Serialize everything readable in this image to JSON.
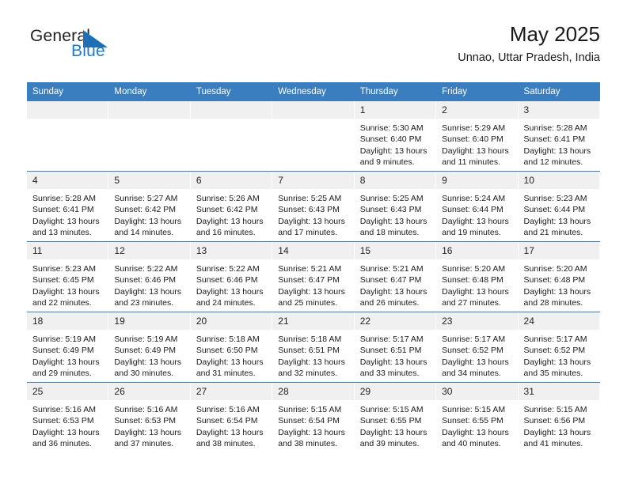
{
  "brand": {
    "name_part1": "General",
    "name_part2": "Blue",
    "triangle_color": "#1f6fb4",
    "blue_color": "#1e7ac4"
  },
  "header": {
    "title": "May 2025",
    "location": "Unnao, Uttar Pradesh, India",
    "accent_color": "#3a7ebf"
  },
  "weekdays": [
    "Sunday",
    "Monday",
    "Tuesday",
    "Wednesday",
    "Thursday",
    "Friday",
    "Saturday"
  ],
  "weeks": [
    [
      {
        "day": "",
        "sunrise": "",
        "sunset": "",
        "daylight": ""
      },
      {
        "day": "",
        "sunrise": "",
        "sunset": "",
        "daylight": ""
      },
      {
        "day": "",
        "sunrise": "",
        "sunset": "",
        "daylight": ""
      },
      {
        "day": "",
        "sunrise": "",
        "sunset": "",
        "daylight": ""
      },
      {
        "day": "1",
        "sunrise": "Sunrise: 5:30 AM",
        "sunset": "Sunset: 6:40 PM",
        "daylight": "Daylight: 13 hours and 9 minutes."
      },
      {
        "day": "2",
        "sunrise": "Sunrise: 5:29 AM",
        "sunset": "Sunset: 6:40 PM",
        "daylight": "Daylight: 13 hours and 11 minutes."
      },
      {
        "day": "3",
        "sunrise": "Sunrise: 5:28 AM",
        "sunset": "Sunset: 6:41 PM",
        "daylight": "Daylight: 13 hours and 12 minutes."
      }
    ],
    [
      {
        "day": "4",
        "sunrise": "Sunrise: 5:28 AM",
        "sunset": "Sunset: 6:41 PM",
        "daylight": "Daylight: 13 hours and 13 minutes."
      },
      {
        "day": "5",
        "sunrise": "Sunrise: 5:27 AM",
        "sunset": "Sunset: 6:42 PM",
        "daylight": "Daylight: 13 hours and 14 minutes."
      },
      {
        "day": "6",
        "sunrise": "Sunrise: 5:26 AM",
        "sunset": "Sunset: 6:42 PM",
        "daylight": "Daylight: 13 hours and 16 minutes."
      },
      {
        "day": "7",
        "sunrise": "Sunrise: 5:25 AM",
        "sunset": "Sunset: 6:43 PM",
        "daylight": "Daylight: 13 hours and 17 minutes."
      },
      {
        "day": "8",
        "sunrise": "Sunrise: 5:25 AM",
        "sunset": "Sunset: 6:43 PM",
        "daylight": "Daylight: 13 hours and 18 minutes."
      },
      {
        "day": "9",
        "sunrise": "Sunrise: 5:24 AM",
        "sunset": "Sunset: 6:44 PM",
        "daylight": "Daylight: 13 hours and 19 minutes."
      },
      {
        "day": "10",
        "sunrise": "Sunrise: 5:23 AM",
        "sunset": "Sunset: 6:44 PM",
        "daylight": "Daylight: 13 hours and 21 minutes."
      }
    ],
    [
      {
        "day": "11",
        "sunrise": "Sunrise: 5:23 AM",
        "sunset": "Sunset: 6:45 PM",
        "daylight": "Daylight: 13 hours and 22 minutes."
      },
      {
        "day": "12",
        "sunrise": "Sunrise: 5:22 AM",
        "sunset": "Sunset: 6:46 PM",
        "daylight": "Daylight: 13 hours and 23 minutes."
      },
      {
        "day": "13",
        "sunrise": "Sunrise: 5:22 AM",
        "sunset": "Sunset: 6:46 PM",
        "daylight": "Daylight: 13 hours and 24 minutes."
      },
      {
        "day": "14",
        "sunrise": "Sunrise: 5:21 AM",
        "sunset": "Sunset: 6:47 PM",
        "daylight": "Daylight: 13 hours and 25 minutes."
      },
      {
        "day": "15",
        "sunrise": "Sunrise: 5:21 AM",
        "sunset": "Sunset: 6:47 PM",
        "daylight": "Daylight: 13 hours and 26 minutes."
      },
      {
        "day": "16",
        "sunrise": "Sunrise: 5:20 AM",
        "sunset": "Sunset: 6:48 PM",
        "daylight": "Daylight: 13 hours and 27 minutes."
      },
      {
        "day": "17",
        "sunrise": "Sunrise: 5:20 AM",
        "sunset": "Sunset: 6:48 PM",
        "daylight": "Daylight: 13 hours and 28 minutes."
      }
    ],
    [
      {
        "day": "18",
        "sunrise": "Sunrise: 5:19 AM",
        "sunset": "Sunset: 6:49 PM",
        "daylight": "Daylight: 13 hours and 29 minutes."
      },
      {
        "day": "19",
        "sunrise": "Sunrise: 5:19 AM",
        "sunset": "Sunset: 6:49 PM",
        "daylight": "Daylight: 13 hours and 30 minutes."
      },
      {
        "day": "20",
        "sunrise": "Sunrise: 5:18 AM",
        "sunset": "Sunset: 6:50 PM",
        "daylight": "Daylight: 13 hours and 31 minutes."
      },
      {
        "day": "21",
        "sunrise": "Sunrise: 5:18 AM",
        "sunset": "Sunset: 6:51 PM",
        "daylight": "Daylight: 13 hours and 32 minutes."
      },
      {
        "day": "22",
        "sunrise": "Sunrise: 5:17 AM",
        "sunset": "Sunset: 6:51 PM",
        "daylight": "Daylight: 13 hours and 33 minutes."
      },
      {
        "day": "23",
        "sunrise": "Sunrise: 5:17 AM",
        "sunset": "Sunset: 6:52 PM",
        "daylight": "Daylight: 13 hours and 34 minutes."
      },
      {
        "day": "24",
        "sunrise": "Sunrise: 5:17 AM",
        "sunset": "Sunset: 6:52 PM",
        "daylight": "Daylight: 13 hours and 35 minutes."
      }
    ],
    [
      {
        "day": "25",
        "sunrise": "Sunrise: 5:16 AM",
        "sunset": "Sunset: 6:53 PM",
        "daylight": "Daylight: 13 hours and 36 minutes."
      },
      {
        "day": "26",
        "sunrise": "Sunrise: 5:16 AM",
        "sunset": "Sunset: 6:53 PM",
        "daylight": "Daylight: 13 hours and 37 minutes."
      },
      {
        "day": "27",
        "sunrise": "Sunrise: 5:16 AM",
        "sunset": "Sunset: 6:54 PM",
        "daylight": "Daylight: 13 hours and 38 minutes."
      },
      {
        "day": "28",
        "sunrise": "Sunrise: 5:15 AM",
        "sunset": "Sunset: 6:54 PM",
        "daylight": "Daylight: 13 hours and 38 minutes."
      },
      {
        "day": "29",
        "sunrise": "Sunrise: 5:15 AM",
        "sunset": "Sunset: 6:55 PM",
        "daylight": "Daylight: 13 hours and 39 minutes."
      },
      {
        "day": "30",
        "sunrise": "Sunrise: 5:15 AM",
        "sunset": "Sunset: 6:55 PM",
        "daylight": "Daylight: 13 hours and 40 minutes."
      },
      {
        "day": "31",
        "sunrise": "Sunrise: 5:15 AM",
        "sunset": "Sunset: 6:56 PM",
        "daylight": "Daylight: 13 hours and 41 minutes."
      }
    ]
  ]
}
